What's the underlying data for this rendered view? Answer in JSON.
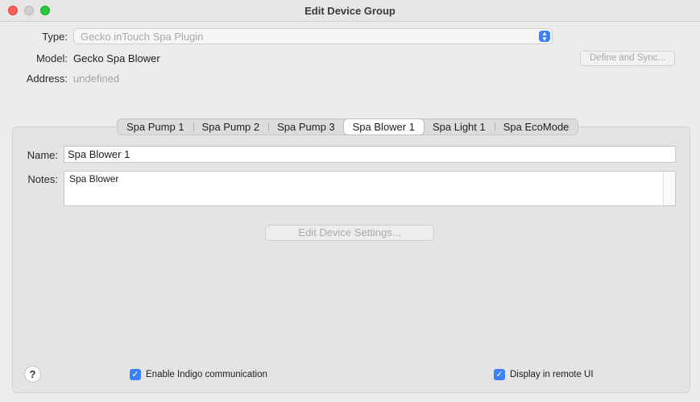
{
  "window": {
    "title": "Edit Device Group"
  },
  "fields": {
    "type_label": "Type:",
    "type_value": "Gecko inTouch Spa Plugin",
    "model_label": "Model:",
    "model_value": "Gecko Spa Blower",
    "address_label": "Address:",
    "address_value": "undefined",
    "define_sync_label": "Define and Sync..."
  },
  "tabs": [
    {
      "label": "Spa Pump 1",
      "active": false
    },
    {
      "label": "Spa Pump 2",
      "active": false
    },
    {
      "label": "Spa Pump 3",
      "active": false
    },
    {
      "label": "Spa Blower 1",
      "active": true
    },
    {
      "label": "Spa Light 1",
      "active": false
    },
    {
      "label": "Spa EcoMode",
      "active": false
    }
  ],
  "device": {
    "name_label": "Name:",
    "name_value": "Spa Blower 1",
    "notes_label": "Notes:",
    "notes_value": "Spa Blower",
    "edit_settings_label": "Edit Device Settings..."
  },
  "footer": {
    "help_label": "?",
    "enable_comm_label": "Enable Indigo communication",
    "enable_comm_checked": true,
    "remote_ui_label": "Display in remote UI",
    "remote_ui_checked": true
  },
  "colors": {
    "accent": "#3b82f6",
    "close": "#ff5f57",
    "maximize": "#28c840"
  },
  "icons": {
    "check": "checkmark-icon",
    "select": "updown-chevron-icon"
  }
}
